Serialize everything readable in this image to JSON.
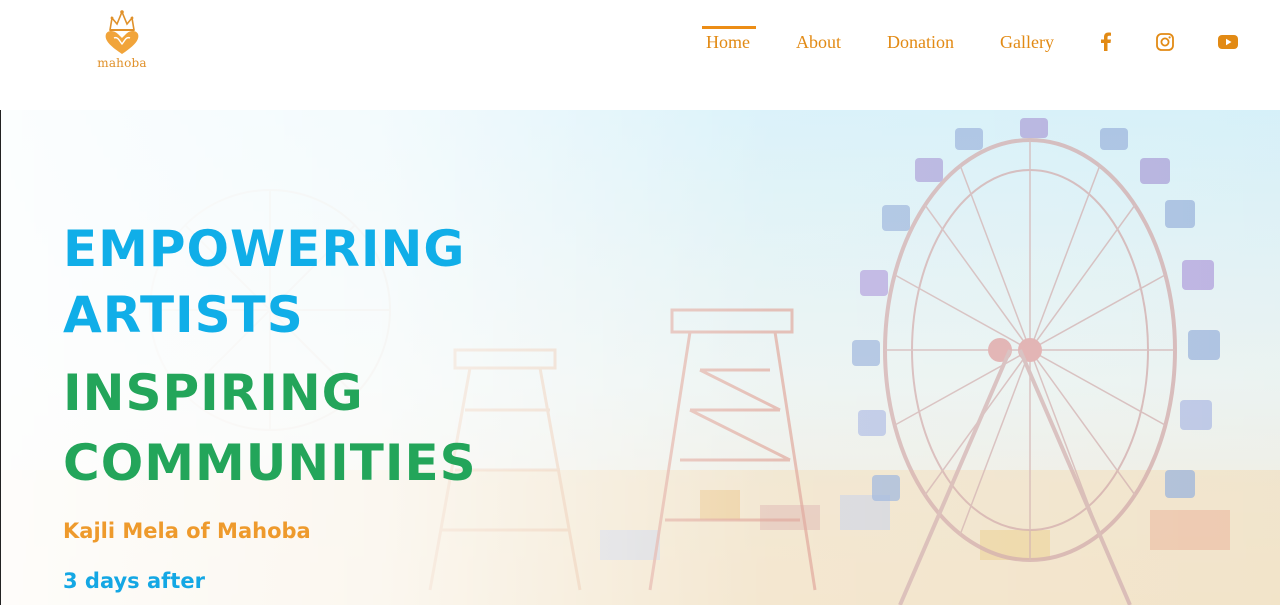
{
  "brand": {
    "logo_text": "mahoba",
    "logo_icon": "crown-heart-logo-icon",
    "accent_color": "#e28a14"
  },
  "nav": {
    "items": [
      {
        "label": "Home",
        "active": true
      },
      {
        "label": "About",
        "active": false
      },
      {
        "label": "Donation",
        "active": false
      },
      {
        "label": "Gallery",
        "active": false
      }
    ],
    "social": [
      {
        "icon": "facebook-icon"
      },
      {
        "icon": "instagram-icon"
      },
      {
        "icon": "youtube-icon"
      }
    ]
  },
  "hero": {
    "headline_line1": "EMPOWERING",
    "headline_line2": "ARTISTS",
    "headline_line3": "INSPIRING",
    "headline_line4": "COMMUNITIES",
    "event_name": "Kajli Mela of Mahoba",
    "event_timing": "3 days after",
    "background_image": "ferris-wheel-fair-photo",
    "colors": {
      "blue": "#10aee8",
      "green": "#23a55a",
      "orange": "#ee9a2c"
    }
  }
}
